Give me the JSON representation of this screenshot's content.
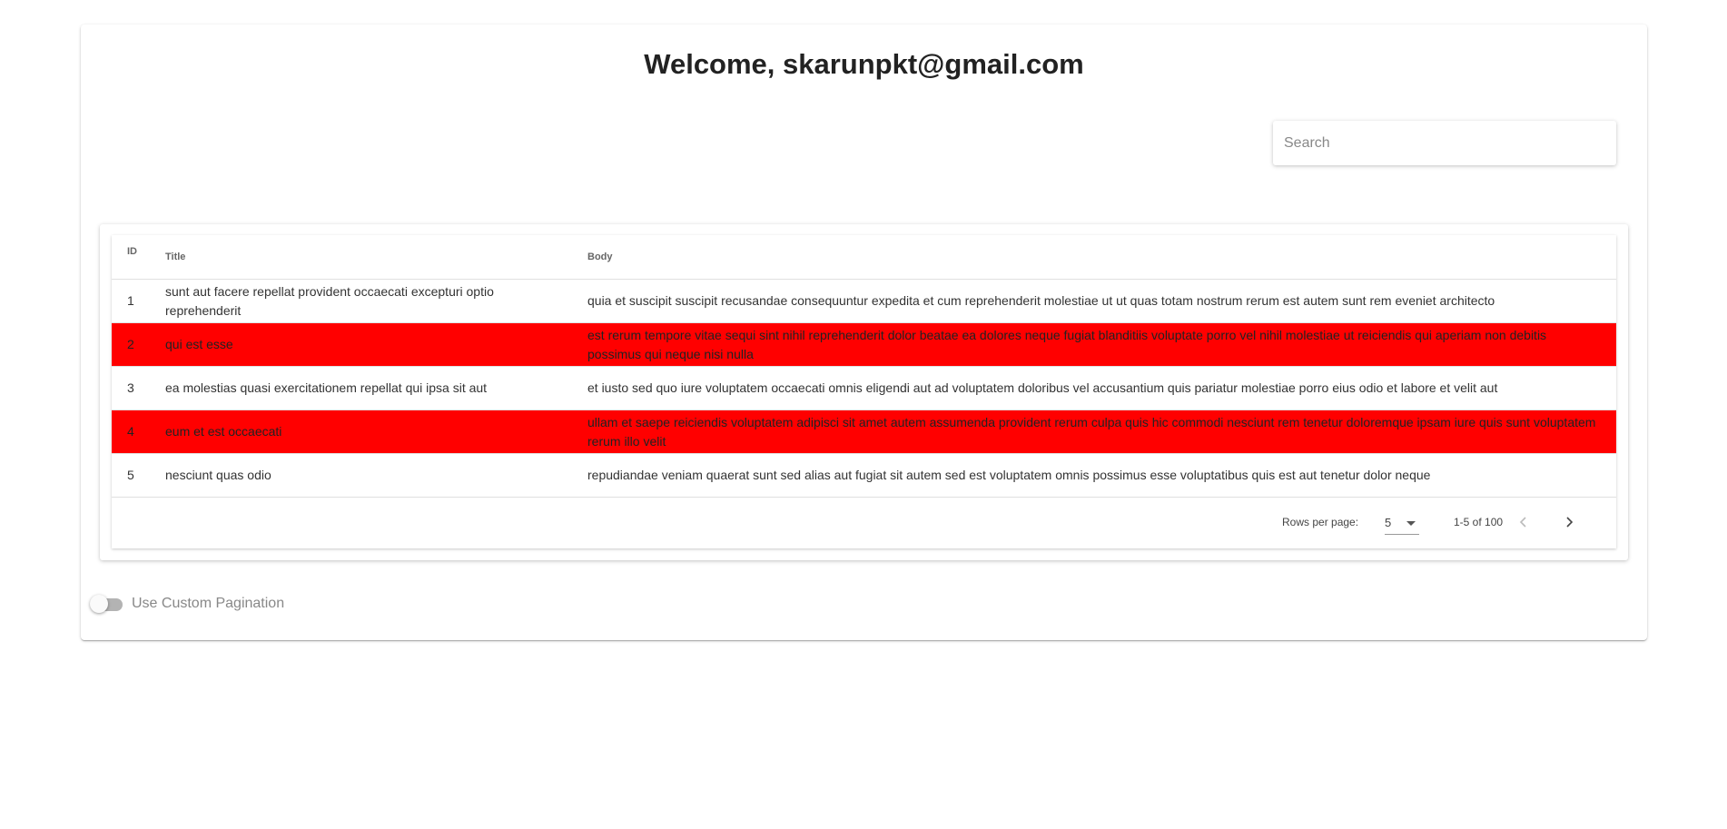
{
  "header": {
    "title": "Welcome, skarunpkt@gmail.com"
  },
  "search": {
    "placeholder": "Search",
    "value": ""
  },
  "table": {
    "columns": {
      "id": "ID",
      "title": "Title",
      "body": "Body"
    },
    "highlight_color": "#ff0000",
    "rows": [
      {
        "id": "1",
        "title": "sunt aut facere repellat provident occaecati excepturi optio reprehenderit",
        "body": "quia et suscipit suscipit recusandae consequuntur expedita et cum reprehenderit molestiae ut ut quas totam nostrum rerum est autem sunt rem eveniet architecto",
        "highlighted": false
      },
      {
        "id": "2",
        "title": "qui est esse",
        "body": "est rerum tempore vitae sequi sint nihil reprehenderit dolor beatae ea dolores neque fugiat blanditiis voluptate porro vel nihil molestiae ut reiciendis qui aperiam non debitis possimus qui neque nisi nulla",
        "highlighted": true
      },
      {
        "id": "3",
        "title": "ea molestias quasi exercitationem repellat qui ipsa sit aut",
        "body": "et iusto sed quo iure voluptatem occaecati omnis eligendi aut ad voluptatem doloribus vel accusantium quis pariatur molestiae porro eius odio et labore et velit aut",
        "highlighted": false
      },
      {
        "id": "4",
        "title": "eum et est occaecati",
        "body": "ullam et saepe reiciendis voluptatem adipisci sit amet autem assumenda provident rerum culpa quis hic commodi nesciunt rem tenetur doloremque ipsam iure quis sunt voluptatem rerum illo velit",
        "highlighted": true
      },
      {
        "id": "5",
        "title": "nesciunt quas odio",
        "body": "repudiandae veniam quaerat sunt sed alias aut fugiat sit autem sed est voluptatem omnis possimus esse voluptatibus quis est aut tenetur dolor neque",
        "highlighted": false
      }
    ]
  },
  "pagination": {
    "rows_per_page_label": "Rows per page:",
    "rows_per_page": "5",
    "range": "1-5 of 100",
    "prev_icon": "chevron-left-icon",
    "next_icon": "chevron-right-icon"
  },
  "toggle": {
    "label": "Use Custom Pagination",
    "on": false
  }
}
